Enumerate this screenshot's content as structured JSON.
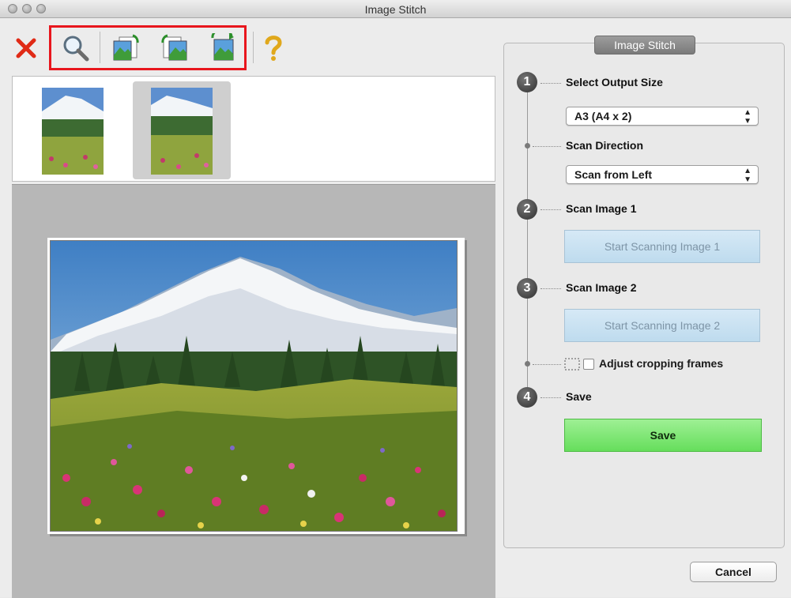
{
  "window": {
    "title": "Image Stitch",
    "traffic_lights": [
      "close",
      "minimize",
      "zoom"
    ]
  },
  "toolbar": {
    "buttons": [
      {
        "name": "clear-icon",
        "label": "Clear"
      },
      {
        "name": "enlarge-icon",
        "label": "Enlarge/Reduce"
      },
      {
        "name": "swap-left-image-icon",
        "label": "Swap left image"
      },
      {
        "name": "swap-right-image-icon",
        "label": "Swap right image"
      },
      {
        "name": "rotate-image-icon",
        "label": "Rotate"
      },
      {
        "name": "help-icon",
        "label": "Help"
      }
    ],
    "highlight_color": "#e8161d"
  },
  "thumbnails": [
    {
      "name": "image-1",
      "selected": false
    },
    {
      "name": "image-2",
      "selected": true
    }
  ],
  "panel": {
    "title": "Image Stitch",
    "steps": [
      {
        "number": "1",
        "label": "Select Output Size"
      },
      {
        "number": "2",
        "label": "Scan Image 1"
      },
      {
        "number": "3",
        "label": "Scan Image 2"
      },
      {
        "number": "4",
        "label": "Save"
      }
    ],
    "output_size": {
      "selected": "A3 (A4 x 2)"
    },
    "scan_direction": {
      "label": "Scan Direction",
      "selected": "Scan from Left"
    },
    "scan_image1_button": "Start Scanning Image 1",
    "scan_image2_button": "Start Scanning Image 2",
    "adjust_cropping": {
      "label": "Adjust cropping frames",
      "checked": false
    },
    "save_button": "Save"
  },
  "footer": {
    "cancel_label": "Cancel"
  },
  "colors": {
    "save_green": "#66de5c",
    "scan_button_blue": "#bedbee"
  }
}
